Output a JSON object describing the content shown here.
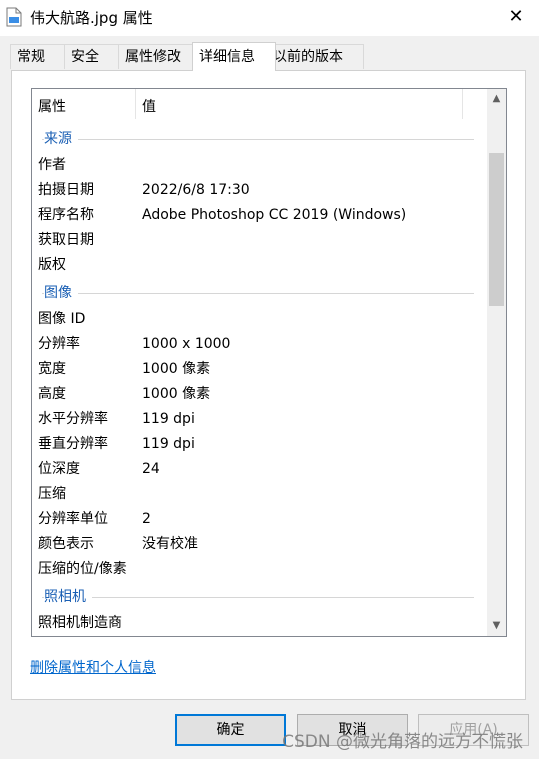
{
  "window": {
    "title": "伟大航路.jpg 属性",
    "close_glyph": "✕"
  },
  "tabs": [
    {
      "label": "常规",
      "active": false
    },
    {
      "label": "安全",
      "active": false
    },
    {
      "label": "属性修改",
      "active": false
    },
    {
      "label": "详细信息",
      "active": true
    },
    {
      "label": "以前的版本",
      "active": false
    }
  ],
  "details": {
    "header": {
      "property": "属性",
      "value": "值"
    },
    "sections": [
      {
        "title": "来源",
        "rows": [
          {
            "k": "作者",
            "v": ""
          },
          {
            "k": "拍摄日期",
            "v": "2022/6/8 17:30"
          },
          {
            "k": "程序名称",
            "v": "Adobe Photoshop CC 2019 (Windows)"
          },
          {
            "k": "获取日期",
            "v": ""
          },
          {
            "k": "版权",
            "v": ""
          }
        ]
      },
      {
        "title": "图像",
        "rows": [
          {
            "k": "图像 ID",
            "v": ""
          },
          {
            "k": "分辨率",
            "v": "1000 x 1000"
          },
          {
            "k": "宽度",
            "v": "1000 像素"
          },
          {
            "k": "高度",
            "v": "1000 像素"
          },
          {
            "k": "水平分辨率",
            "v": "119 dpi"
          },
          {
            "k": "垂直分辨率",
            "v": "119 dpi"
          },
          {
            "k": "位深度",
            "v": "24"
          },
          {
            "k": "压缩",
            "v": ""
          },
          {
            "k": "分辨率单位",
            "v": "2"
          },
          {
            "k": "颜色表示",
            "v": "没有校准"
          },
          {
            "k": "压缩的位/像素",
            "v": ""
          }
        ]
      },
      {
        "title": "照相机",
        "rows": [
          {
            "k": "照相机制造商",
            "v": ""
          }
        ]
      }
    ]
  },
  "link": "删除属性和个人信息",
  "buttons": {
    "ok": "确定",
    "cancel": "取消",
    "apply": "应用(A)"
  },
  "watermark": "CSDN @微光角落的远方不慌张",
  "colors": {
    "section_title": "#1a5fb4",
    "link": "#0066cc",
    "default_button_border": "#0078d7"
  }
}
